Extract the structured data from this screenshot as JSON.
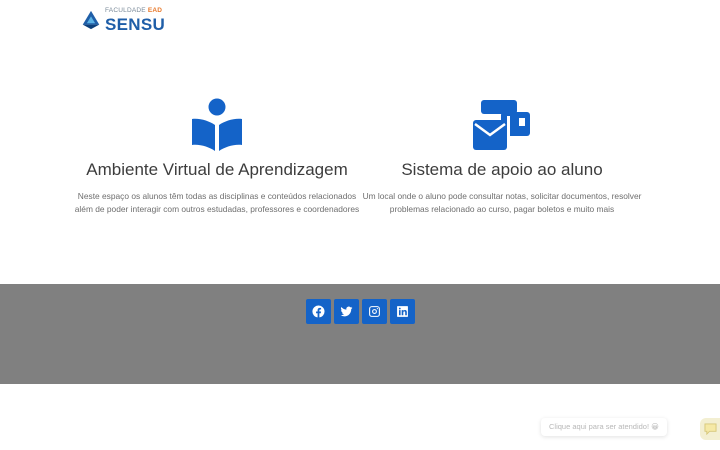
{
  "header": {
    "logo_top_prefix": "FACULDADE",
    "logo_top_accent": "EAD",
    "logo_main": "SENSU"
  },
  "features": [
    {
      "icon": "book-reader-icon",
      "title": "Ambiente Virtual de Aprendizagem",
      "line1": "Neste espaço os alunos têm todas as disciplinas e conteúdos relacionados",
      "line2": "além de poder interagir com outros estudadas, professores e coordenadores"
    },
    {
      "icon": "mail-bulk-icon",
      "title": "Sistema de apoio ao aluno",
      "line1": "Um local onde o aluno pode consultar notas, solicitar documentos, resolver",
      "line2": "problemas relacionado ao curso, pagar boletos e muito mais"
    }
  ],
  "footer": {
    "social": [
      "facebook-icon",
      "twitter-icon",
      "instagram-icon",
      "linkedin-icon"
    ]
  },
  "chat": {
    "label": "Clique aqui para ser atendido! 😀",
    "icon": "chat-icon"
  },
  "colors": {
    "accent_blue": "#1463c8",
    "footer_gray": "#808080",
    "logo_blue": "#1f5ea8",
    "logo_orange": "#e8792b"
  }
}
